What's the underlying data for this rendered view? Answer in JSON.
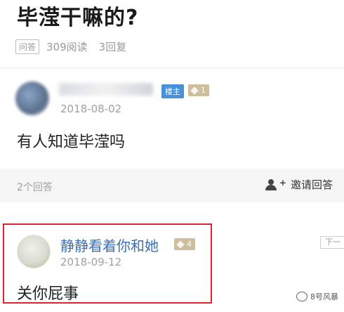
{
  "post": {
    "title": "毕滢干嘛的?",
    "tag": "问答",
    "reads": "309阅读",
    "replies": "3回复",
    "author_badge": "楼主",
    "author_level": "1",
    "date": "2018-08-02",
    "body": "有人知道毕滢吗"
  },
  "answers_bar": {
    "count_label": "2个回答",
    "invite_label": "邀请回答"
  },
  "reply": {
    "username": "静静看着你和她",
    "level": "4",
    "date": "2018-09-12",
    "body": "关你屁事",
    "highlight_color": "#e0242d"
  },
  "side": {
    "next_label": "下一"
  },
  "watermark": {
    "text": "8号风暴"
  },
  "colors": {
    "link_blue": "#3a6fb5",
    "host_badge": "#4a90d9",
    "level_badge": "#cdbf9e"
  }
}
